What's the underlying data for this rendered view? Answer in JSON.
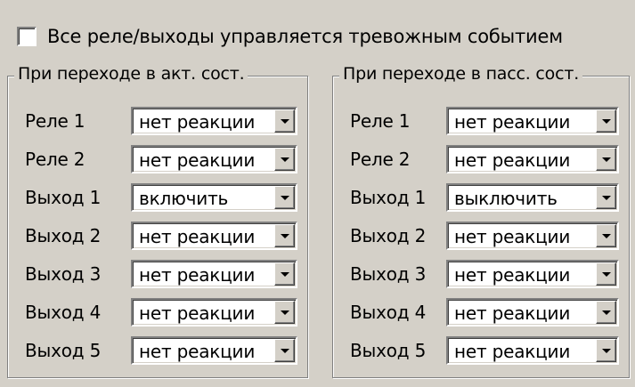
{
  "master": {
    "checked": false,
    "label": "Все реле/выходы управляется тревожным событием"
  },
  "groups": [
    {
      "title": "При переходе в акт. сост.",
      "rows": [
        {
          "label": "Реле 1",
          "value": "нет реакции"
        },
        {
          "label": "Реле 2",
          "value": "нет реакции"
        },
        {
          "label": "Выход 1",
          "value": "включить"
        },
        {
          "label": "Выход 2",
          "value": "нет реакции"
        },
        {
          "label": "Выход 3",
          "value": "нет реакции"
        },
        {
          "label": "Выход 4",
          "value": "нет реакции"
        },
        {
          "label": "Выход 5",
          "value": "нет реакции"
        }
      ]
    },
    {
      "title": "При переходе в пасс. сост.",
      "rows": [
        {
          "label": "Реле 1",
          "value": "нет реакции"
        },
        {
          "label": "Реле 2",
          "value": "нет реакции"
        },
        {
          "label": "Выход 1",
          "value": "выключить"
        },
        {
          "label": "Выход 2",
          "value": "нет реакции"
        },
        {
          "label": "Выход 3",
          "value": "нет реакции"
        },
        {
          "label": "Выход 4",
          "value": "нет реакции"
        },
        {
          "label": "Выход 5",
          "value": "нет реакции"
        }
      ]
    }
  ],
  "icons": {
    "dropdown": "chevron-down-icon"
  },
  "colors": {
    "window_bg": "#d4d0c8",
    "field_bg": "#ffffff",
    "text": "#000000"
  }
}
